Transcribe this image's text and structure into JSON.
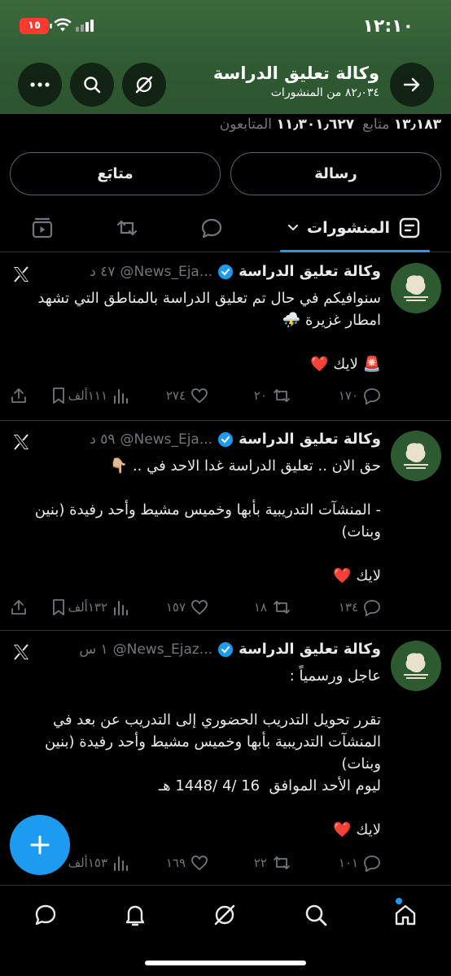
{
  "status_bar": {
    "time": "١٢:١٠",
    "battery": "١٥"
  },
  "header": {
    "title": "وكالة تعليق الدراسة",
    "subtitle": "٨٢٫٠٣٤ من المنشورات",
    "icons": [
      "back-arrow-icon",
      "grok-icon",
      "search-icon",
      "more-icon"
    ]
  },
  "profile": {
    "following_count": "١٣٫١٨٣",
    "following_label": "متابع",
    "followers_count": "١١٫٣٠١٫٦٢٧",
    "followers_label": "المتابعون",
    "message_button": "رسالة",
    "follow_button": "متابَع"
  },
  "tabs": {
    "posts_label": "المنشورات"
  },
  "posts": [
    {
      "name": "وكالة تعليق الدراسة",
      "handle": "@News_Eja...",
      "time": "٤٧ د",
      "body": "سنوافيكم في حال تم تعليق الدراسة بالمناطق التي تشهد امطار غزيرة ⛈️\n\n🚨 لايك ❤️",
      "replies": "١٧٠",
      "reposts": "٢٠",
      "likes": "٢٧٤",
      "views": "١١١ألف"
    },
    {
      "name": "وكالة تعليق الدراسة",
      "handle": "@News_Eja...",
      "time": "٥٩ د",
      "body": "حق الان .. تعليق الدراسة غدا الاحد في .. 👇🏼\n\n- المنشآت التدريبية بأبها وخميس مشيط وأحد رفيدة (بنين وبنات)\n\nلايك ❤️",
      "replies": "١٣٤",
      "reposts": "١٨",
      "likes": "١٥٧",
      "views": "١٣٢ألف"
    },
    {
      "name": "وكالة تعليق الدراسة",
      "handle": "@News_Ejaz...",
      "time": "١ س",
      "body": "عاجل ورسمياً :\n\nتقرر تحويل التدريب الحضوري إلى التدريب عن بعد في المنشآت التدريبية بأبها وخميس مشيط وأحد رفيدة (بنين وبنات)\nليوم الأحد الموافق  16 /4 /1448 هـ\n\nلايك ❤️",
      "replies": "١٠١",
      "reposts": "٢٢",
      "likes": "١٦٩",
      "views": "١٥٣ألف"
    }
  ],
  "fab": {
    "icon": "plus-icon"
  },
  "bottom_nav": [
    "home-icon",
    "search-icon",
    "grok-icon",
    "notifications-icon",
    "messages-icon"
  ]
}
